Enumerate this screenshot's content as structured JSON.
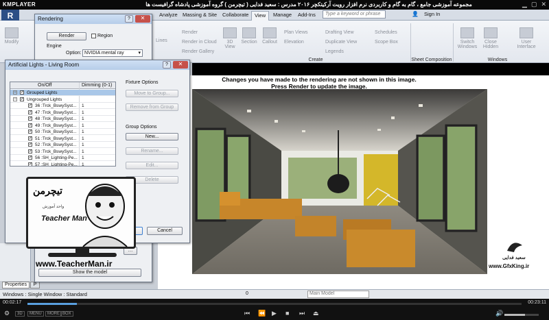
{
  "player": {
    "logo": "KMPLAYER",
    "title": "مجموعه آموزشی جامع ، گام به گام و کاربردی نرم افزار رویت آرکیتکچر ۲۰۱۶ مدرس : سعید فدایی ( تیچرمن ) گروه آموزشی پادشاه گرافیست ها",
    "time_elapsed": "00:02:17",
    "time_total": "00:23:11",
    "progress_fraction": 0.1,
    "volume_fraction": 0.6,
    "mini_buttons": [
      "3D",
      "MENU",
      "MORE",
      "BOX"
    ]
  },
  "revit": {
    "app_button": "R",
    "tabs": [
      "Analyze",
      "Massing & Site",
      "Collaborate",
      "View",
      "Manage",
      "Add-Ins",
      "Modify"
    ],
    "active_tab": "View",
    "search_placeholder": "Type a keyword or phrase",
    "sign_in": "Sign In",
    "ribbon": {
      "modify": "Modify",
      "lines": "Lines",
      "render": "Render",
      "render_cloud": "Render in Cloud",
      "render_gallery": "Render Gallery",
      "view_3d": "3D View",
      "section": "Section",
      "callout": "Callout",
      "plan_views": "Plan Views",
      "elevation": "Elevation",
      "drafting_view": "Drafting View",
      "duplicate_view": "Duplicate View",
      "legends": "Legends",
      "schedules": "Schedules",
      "scope_box": "Scope Box",
      "switch_windows": "Switch Windows",
      "close_hidden": "Close Hidden",
      "user_interface": "User Interface",
      "panel_create": "Create",
      "panel_sheet": "Sheet Composition",
      "panel_windows": "Windows"
    },
    "render_message_1": "Changes you have made to the rendering are not shown in this image.",
    "render_message_2": "Press Render to update the image.",
    "status": {
      "windows": "Windows : Single Window : Standard",
      "zoom": "0",
      "model": "Main Model"
    },
    "bottom_tabs": {
      "properties": "Properties",
      "project": "P"
    }
  },
  "rendering_dialog": {
    "title": "Rendering",
    "render_button": "Render",
    "region_label": "Region",
    "engine_label": "Engine",
    "option_label": "Option:",
    "option_value": "NVIDIA mental ray",
    "show_model": "Show the model"
  },
  "lights_dialog": {
    "title": "Artificial Lights - Living Room",
    "col_onoff": "On/Off",
    "col_dimming": "Dimming (0-1)",
    "fixture_options": "Fixture Options",
    "move_to_group": "Move to Group...",
    "remove_from_group": "Remove from Group",
    "group_options": "Group Options",
    "new": "New...",
    "rename": "Rename...",
    "edit": "Edit...",
    "delete": "Delete",
    "ok": "OK",
    "cancel": "Cancel",
    "rows": [
      {
        "name": "Grouped Lights",
        "dim": "",
        "level": 0,
        "selected": true
      },
      {
        "name": "Ungrouped Lights",
        "dim": "",
        "level": 0,
        "selected": false
      },
      {
        "name": "36 :Trck_BswySyst...",
        "dim": "1",
        "level": 1,
        "selected": false
      },
      {
        "name": "47 :Trck_BswySyst...",
        "dim": "1",
        "level": 1,
        "selected": false
      },
      {
        "name": "48 :Trck_BswySyst...",
        "dim": "1",
        "level": 1,
        "selected": false
      },
      {
        "name": "49 :Trck_BswySyst...",
        "dim": "1",
        "level": 1,
        "selected": false
      },
      {
        "name": "50 :Trck_BswySyst...",
        "dim": "1",
        "level": 1,
        "selected": false
      },
      {
        "name": "51 :Trck_BswySyst...",
        "dim": "1",
        "level": 1,
        "selected": false
      },
      {
        "name": "52 :Trck_BswySyst...",
        "dim": "1",
        "level": 1,
        "selected": false
      },
      {
        "name": "53 :Trck_BswySyst...",
        "dim": "1",
        "level": 1,
        "selected": false
      },
      {
        "name": "56 :SH_Lighting-Pe...",
        "dim": "1",
        "level": 1,
        "selected": false
      },
      {
        "name": "57 :SH_Lighting-Pe...",
        "dim": "1",
        "level": 1,
        "selected": false
      }
    ]
  },
  "watermark": {
    "logo": "تیچرمن",
    "subtitle": "واحد آموزش",
    "name": "Teacher Man",
    "url": "www.TeacherMan.ir",
    "gfx_name": "سعید فدایی",
    "gfx_url": "www.GfxKing.ir"
  },
  "colors": {
    "ribbon_bg": "#e3e7ee",
    "dialog_title": "#b6cde9",
    "selection": "#a9c7e8",
    "player_bar": "#111111",
    "seek_fill": "#5aa0e0"
  }
}
